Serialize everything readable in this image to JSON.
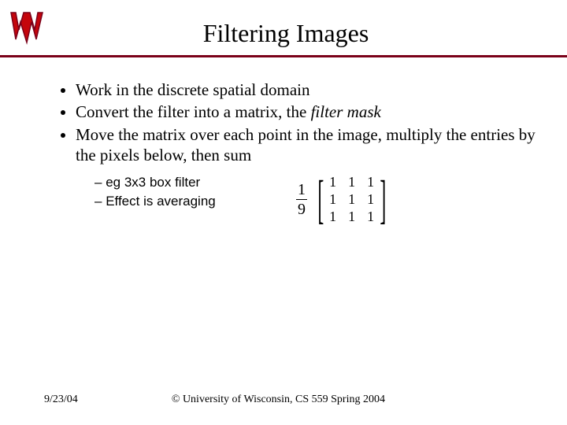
{
  "title": "Filtering Images",
  "bullets": {
    "b1": "Work in the discrete spatial domain",
    "b2_pre": "Convert the filter into a matrix, the ",
    "b2_em": "filter mask",
    "b3": "Move the matrix over each point in the image, multiply the entries by the pixels below, then sum"
  },
  "sub": {
    "s1": "eg 3x3 box filter",
    "s2": "Effect is averaging"
  },
  "matrix": {
    "fraction_num": "1",
    "fraction_den": "9",
    "cells": [
      "1",
      "1",
      "1",
      "1",
      "1",
      "1",
      "1",
      "1",
      "1"
    ]
  },
  "footer": {
    "date": "9/23/04",
    "copyright": "© University of Wisconsin, CS 559 Spring 2004"
  },
  "logo": {
    "stroke": "#7a0019",
    "fill": "#c5050c"
  }
}
